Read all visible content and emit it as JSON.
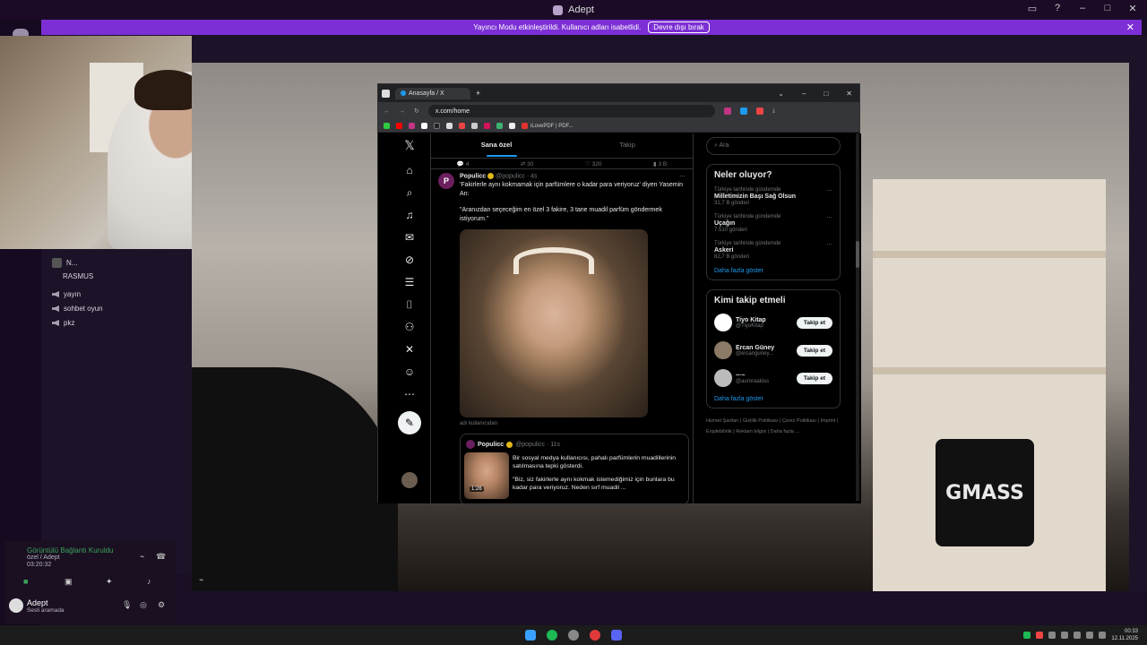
{
  "app": {
    "title": "Adept"
  },
  "banner": {
    "text": "Yayıncı Modu etkinleştirildi. Kullanıcı adları isabetlidi.",
    "button": "Devre dışı bırak"
  },
  "sidebar": {
    "users": [
      "N...",
      "RASMUS"
    ],
    "channels": [
      "yayın",
      "sohbet oyun",
      "pkz"
    ]
  },
  "voice": {
    "status": "Görüntülü Bağlantı Kuruldu",
    "channel": "özel / Adept",
    "time": "03:20:32",
    "user": "Adept",
    "user_status": "Sesli aramada"
  },
  "browser": {
    "tab_title": "Anasayfa / X",
    "url": "x.com/home",
    "bookmark_label": "iLovePDF | PDF..."
  },
  "x": {
    "tabs": [
      "Sana özel",
      "Takip"
    ],
    "prev_actions": [
      "4",
      "30",
      "320",
      "3 B"
    ],
    "post": {
      "avatar_letter": "P",
      "name": "Populicc",
      "handle": "@populicc · 4s",
      "text1": "'Fakirlerle aynı kokmamak için parfümlere o kadar para veriyoruz' diyen Yasemin An:",
      "text2": "\"Aranızdan seçeceğim en özel 3 fakire, 3 tane muadil parfüm göndermek istiyorum.\"",
      "caption": "adı kullanıcıdan"
    },
    "quote": {
      "name": "Populicc",
      "handle": "@populicc · 11s",
      "duration": "1:26",
      "text1": "Bir sosyal medya kullanıcısı, pahalı parfümlerin muadillerinin satılmasına tepki gösterdi.",
      "text2": "\"Biz, siz fakirlerle aynı kokmak istemediğimiz için bunlara bu kadar para veriyoruz. Neden sırf muadil ..."
    },
    "search_placeholder": "Ara",
    "trends_title": "Neler oluyor?",
    "trends": [
      {
        "ctx": "Türkiye tarihinde gündemde",
        "name": "Milletimizin Başı Sağ Olsun",
        "count": "31,7 B gönderi"
      },
      {
        "ctx": "Türkiye tarihinde gündemde",
        "name": "Uçağın",
        "count": "7.510 gönderi"
      },
      {
        "ctx": "Türkiye tarihinde gündemde",
        "name": "Askeri",
        "count": "82,7 B gönderi"
      }
    ],
    "show_more": "Daha fazla göster",
    "who_title": "Kimi takip etmeli",
    "who": [
      {
        "name": "Tiyo Kitap",
        "handle": "@TiyoKitap",
        "color": "#ffffff"
      },
      {
        "name": "Ercan Güney",
        "handle": "@ercanguney...",
        "color": "#8a7a66"
      },
      {
        "name": "~·~",
        "handle": "@auroraakiss",
        "color": "#bbbbbb"
      }
    ],
    "follow_label": "Takip et",
    "footer": [
      "Hizmet Şartları",
      "Gizlilik Politikası",
      "Çerez Politikası",
      "Imprint",
      "Erişilebilirlik",
      "Reklam bilgisi",
      "Daha fazla ..."
    ]
  },
  "stream": {
    "brand_text": "GMASS"
  },
  "clock": {
    "time": "00:33",
    "date": "12.11.2025"
  },
  "colors": {
    "banner": "#7c2fd4",
    "accent": "#1d9bf0"
  }
}
